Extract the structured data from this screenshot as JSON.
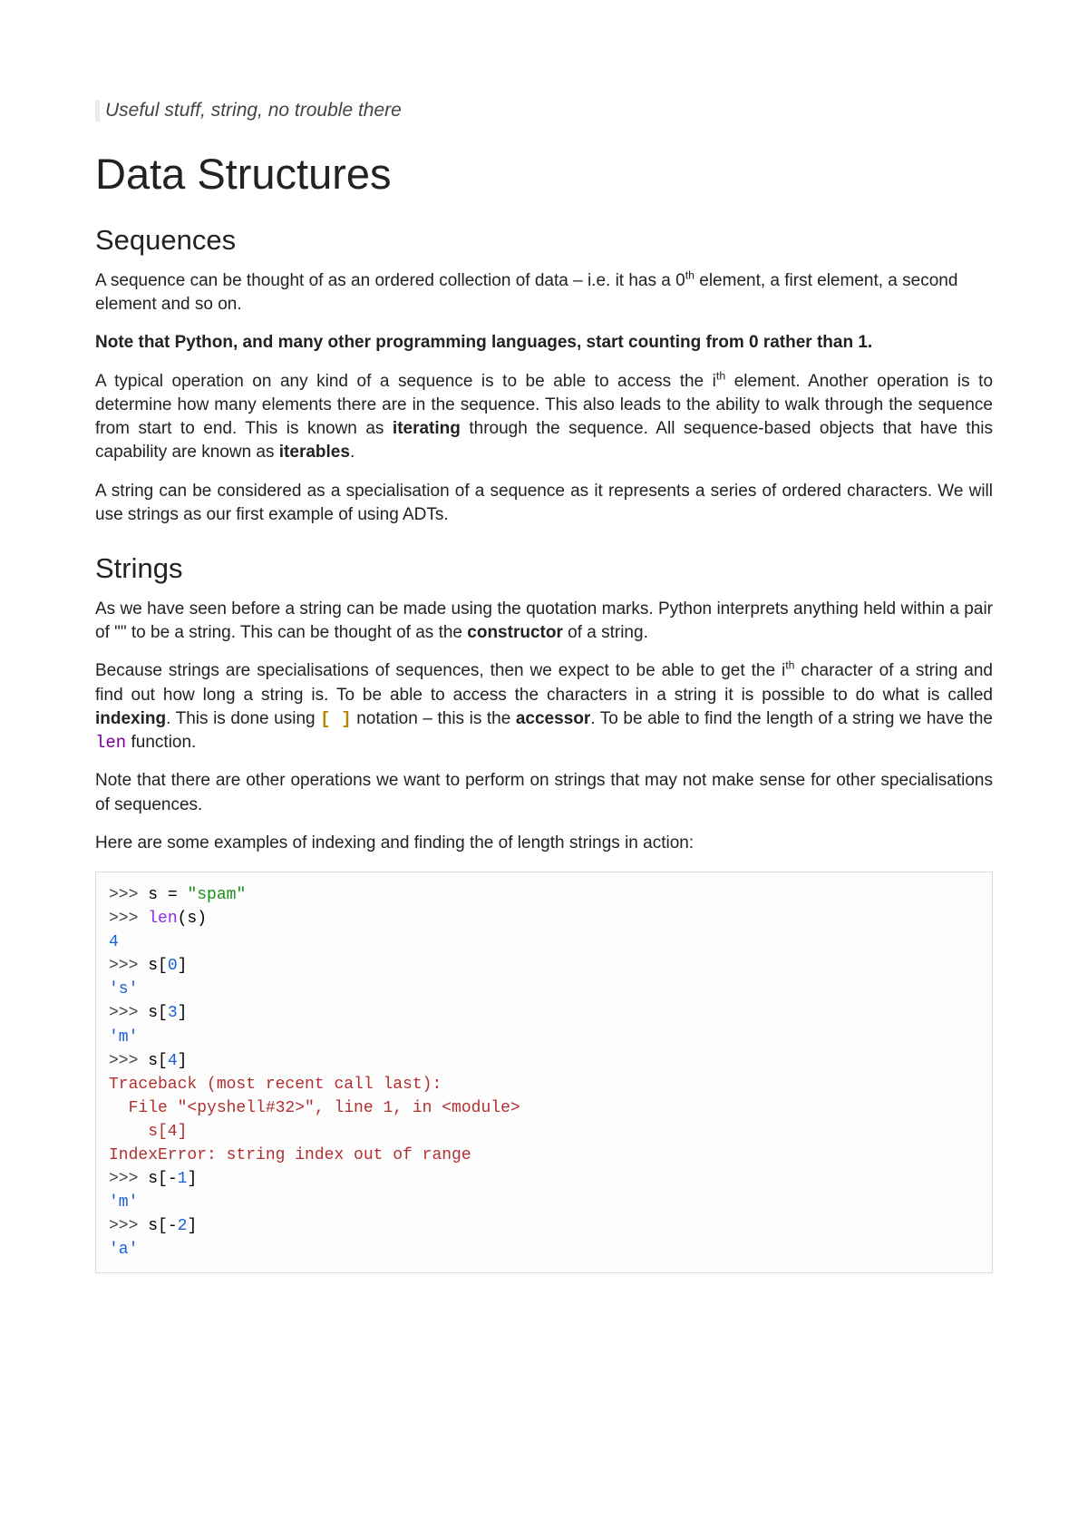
{
  "intro": "Useful stuff, string, no trouble there",
  "h1": "Data Structures",
  "sequences": {
    "heading": "Sequences",
    "p1_a": "A sequence can be thought of as an ordered collection of data – i.e. it has a 0",
    "p1_sup": "th",
    "p1_b": " element, a first element, a second element and so on.",
    "note": "Note that Python, and many other programming languages, start counting from 0 rather than 1.",
    "p2_a": "A typical operation on any kind of a sequence is to be able to access the i",
    "p2_sup": "th",
    "p2_b": " element. Another operation is to determine how many elements there are in the sequence. This also leads to the ability to walk through the sequence from start to end. This is known as ",
    "p2_bold1": "iterating",
    "p2_c": " through the sequence. All sequence-based objects that have this capability are known as ",
    "p2_bold2": "iterables",
    "p2_d": ".",
    "p3": "A string can be considered as a specialisation of a sequence as it represents a series of ordered characters. We will use strings as our first example of using ADTs."
  },
  "strings": {
    "heading": "Strings",
    "p1_a": "As we have seen before a string can be made using the quotation marks. Python interprets anything held within a pair of \"\" to be a string. This can be thought of as the ",
    "p1_bold": "constructor",
    "p1_b": " of a string.",
    "p2_a": "Because strings are specialisations of sequences, then we expect to be able to get the i",
    "p2_sup": "th",
    "p2_b": " character of a string and find out how long a string is. To be able to access the characters in a string it is possible to do what is called ",
    "p2_bold1": "indexing",
    "p2_c": ". This is done using ",
    "p2_brackets": "[ ]",
    "p2_d": " notation – this is the ",
    "p2_bold2": "accessor",
    "p2_e": ". To be able to find the length of a string we have the ",
    "p2_len": "len",
    "p2_f": " function.",
    "p3": "Note that there are other operations we want to perform on strings that may not make sense for other specialisations of sequences.",
    "p4": "Here are some examples of indexing and finding the of length strings in action:"
  },
  "code": {
    "l1a": ">>> ",
    "l1b": "s = ",
    "l1c": "\"spam\"",
    "l2a": ">>> ",
    "l2b": "len",
    "l2c": "(s)",
    "l3": "4",
    "l4a": ">>> ",
    "l4b": "s[",
    "l4c": "0",
    "l4d": "]",
    "l5": "'s'",
    "l6a": ">>> ",
    "l6b": "s[",
    "l6c": "3",
    "l6d": "]",
    "l7": "'m'",
    "l8a": ">>> ",
    "l8b": "s[",
    "l8c": "4",
    "l8d": "]",
    "l9": "Traceback (most recent call last):",
    "l10": "  File \"<pyshell#32>\", line 1, in <module>",
    "l11": "    s[4]",
    "l12": "IndexError: string index out of range",
    "l13a": ">>> ",
    "l13b": "s[-",
    "l13c": "1",
    "l13d": "]",
    "l14": "'m'",
    "l15a": ">>> ",
    "l15b": "s[-",
    "l15c": "2",
    "l15d": "]",
    "l16": "'a'"
  }
}
